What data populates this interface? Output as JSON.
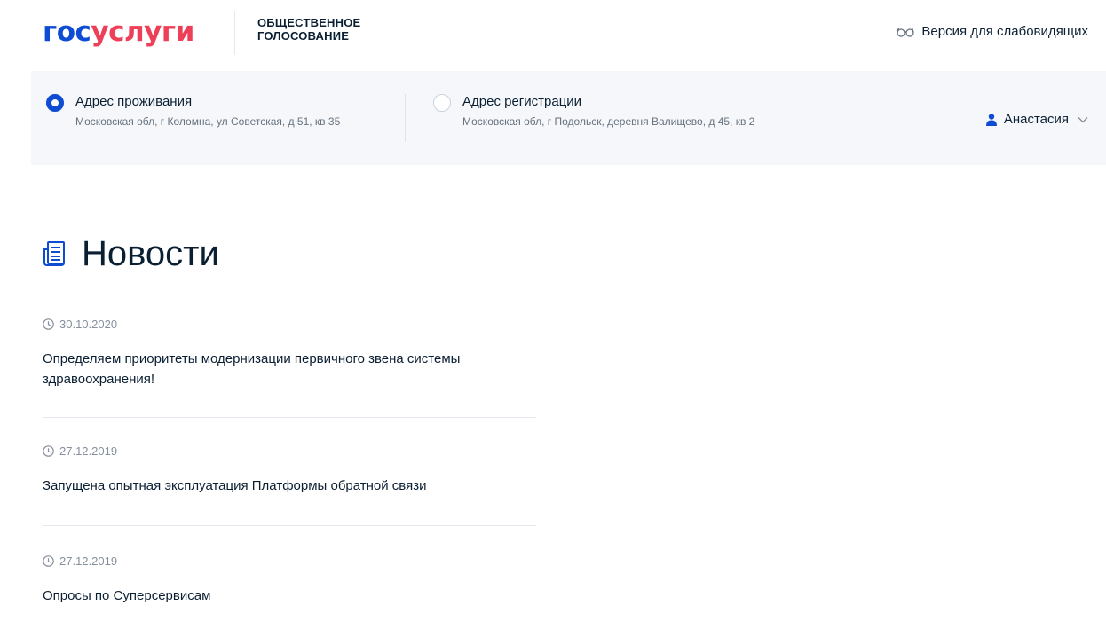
{
  "header": {
    "logo_part1": "гос",
    "logo_part2": "услуги",
    "service_line1": "ОБЩЕСТВЕННОЕ",
    "service_line2": "ГОЛОСОВАНИЕ",
    "accessibility_label": "Версия для слабовидящих"
  },
  "address_bar": {
    "residence": {
      "label": "Адрес проживания",
      "value": "Московская обл, г Коломна, ул Советская, д 51, кв 35",
      "selected": true
    },
    "registration": {
      "label": "Адрес регистрации",
      "value": "Московская обл, г Подольск, деревня Валищево, д 45, кв 2",
      "selected": false
    },
    "user_name": "Анастасия"
  },
  "news": {
    "title": "Новости",
    "items": [
      {
        "date": "30.10.2020",
        "text": "Определяем приоритеты модернизации первичного звена системы здравоохранения!"
      },
      {
        "date": "27.12.2019",
        "text": "Запущена опытная эксплуатация Платформы обратной связи"
      },
      {
        "date": "27.12.2019",
        "text": "Опросы по Суперсервисам"
      }
    ]
  },
  "colors": {
    "brand_blue": "#0d4cd3",
    "brand_red": "#ee3f58",
    "text": "#0b1f33",
    "muted": "#86909c",
    "address_bg": "#f5f7fa"
  }
}
